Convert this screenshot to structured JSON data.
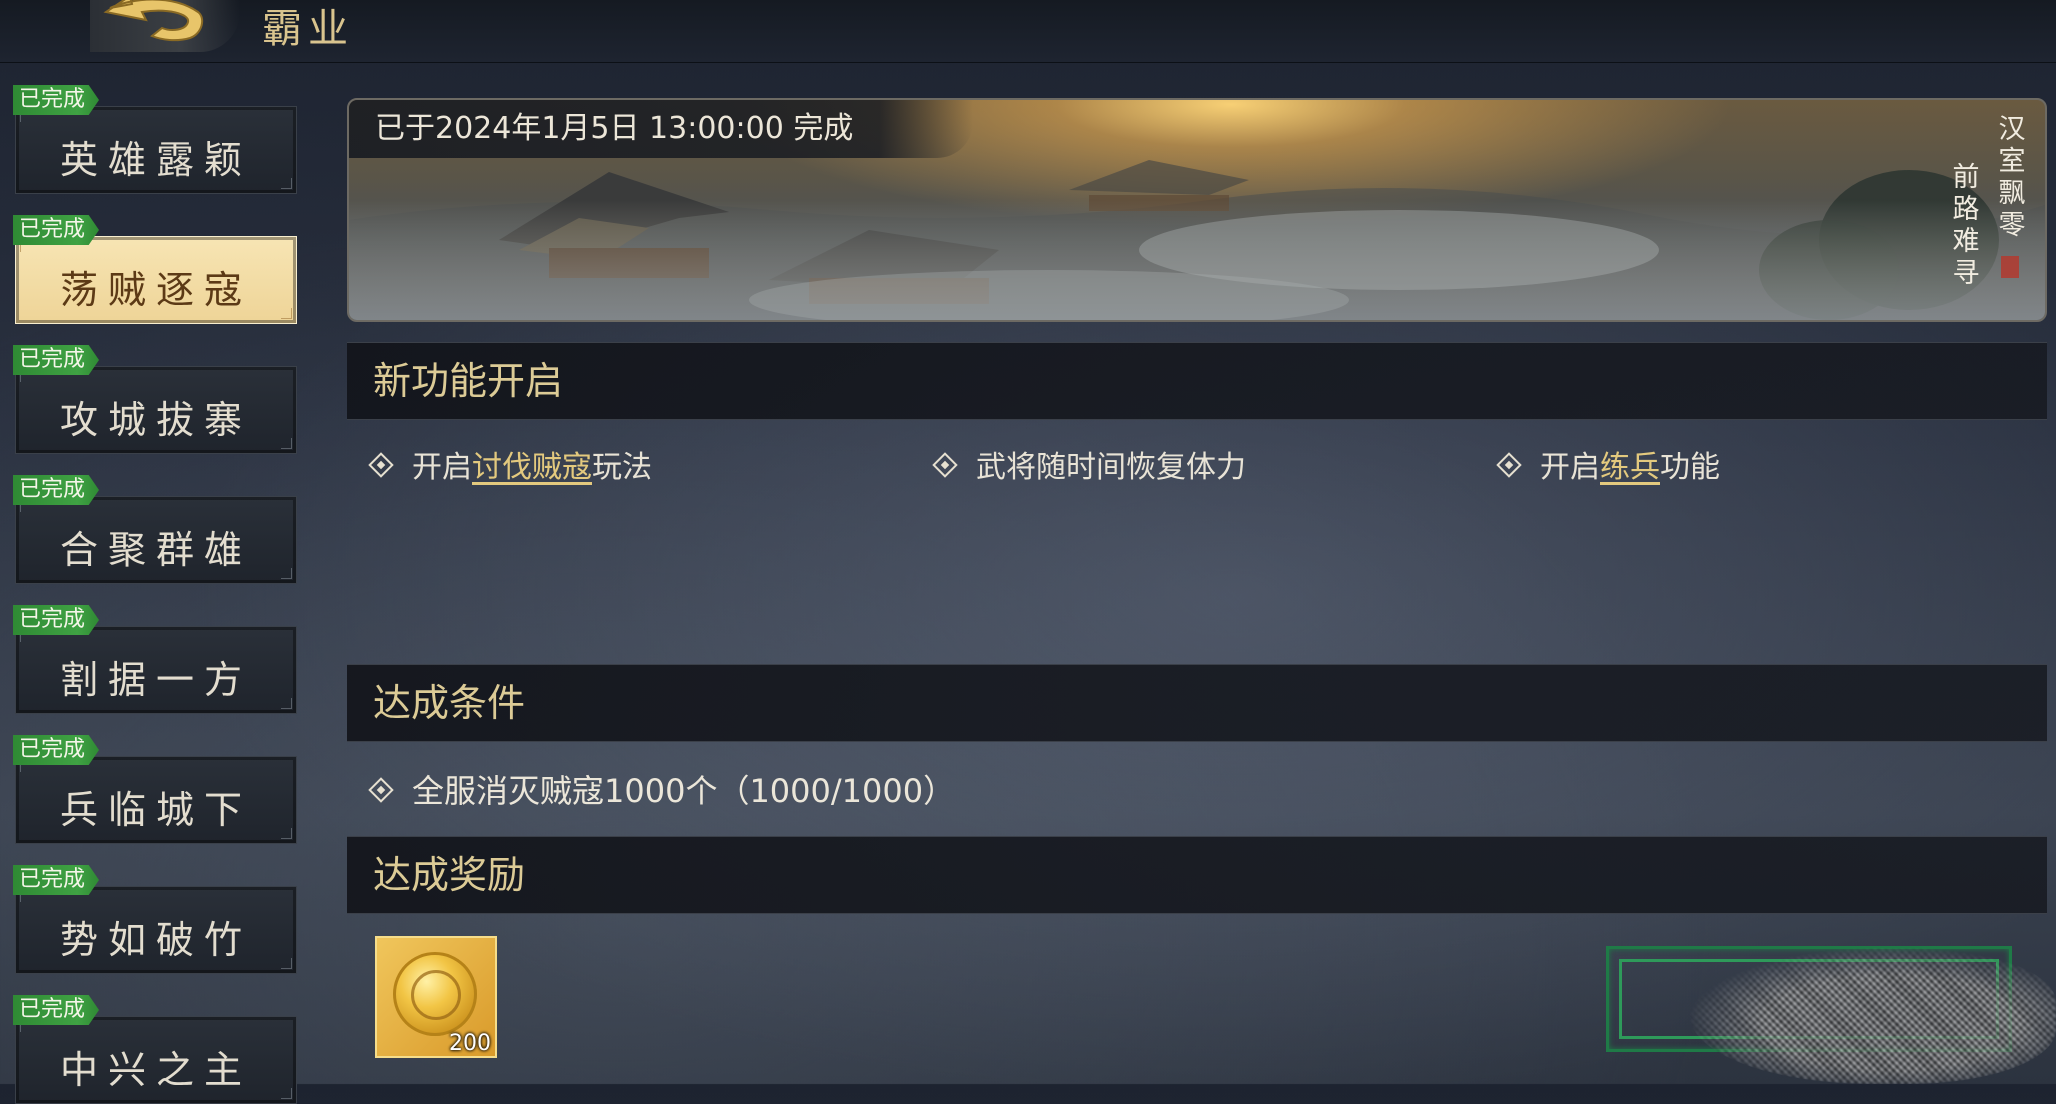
{
  "header": {
    "title": "霸业"
  },
  "sidebar": {
    "badge_label": "已完成",
    "items": [
      {
        "label": "英雄露颖",
        "completed": true,
        "selected": false
      },
      {
        "label": "荡贼逐寇",
        "completed": true,
        "selected": true
      },
      {
        "label": "攻城拔寨",
        "completed": true,
        "selected": false
      },
      {
        "label": "合聚群雄",
        "completed": true,
        "selected": false
      },
      {
        "label": "割据一方",
        "completed": true,
        "selected": false
      },
      {
        "label": "兵临城下",
        "completed": true,
        "selected": false
      },
      {
        "label": "势如破竹",
        "completed": true,
        "selected": false
      },
      {
        "label": "中兴之主",
        "completed": true,
        "selected": false
      }
    ]
  },
  "banner": {
    "caption": "已于2024年1月5日 13:00:00 完成",
    "poem_col1": "汉室飘零",
    "poem_col2": "前路难寻"
  },
  "features": {
    "title": "新功能开启",
    "items": [
      {
        "prefix": "开启",
        "link": "讨伐贼寇",
        "suffix": "玩法"
      },
      {
        "prefix": "武将随时间恢复体力",
        "link": "",
        "suffix": ""
      },
      {
        "prefix": "开启",
        "link": "练兵",
        "suffix": "功能"
      }
    ]
  },
  "conditions": {
    "title": "达成条件",
    "items": [
      "全服消灭贼寇1000个（1000/1000）"
    ]
  },
  "rewards": {
    "title": "达成奖励",
    "items": [
      {
        "icon": "gold-coin-icon",
        "count": "200"
      }
    ]
  },
  "colors": {
    "accent_gold": "#dccb96",
    "badge_green": "#3fa243",
    "selected_tab": "#f3dda5",
    "link": "#e3c97e"
  }
}
